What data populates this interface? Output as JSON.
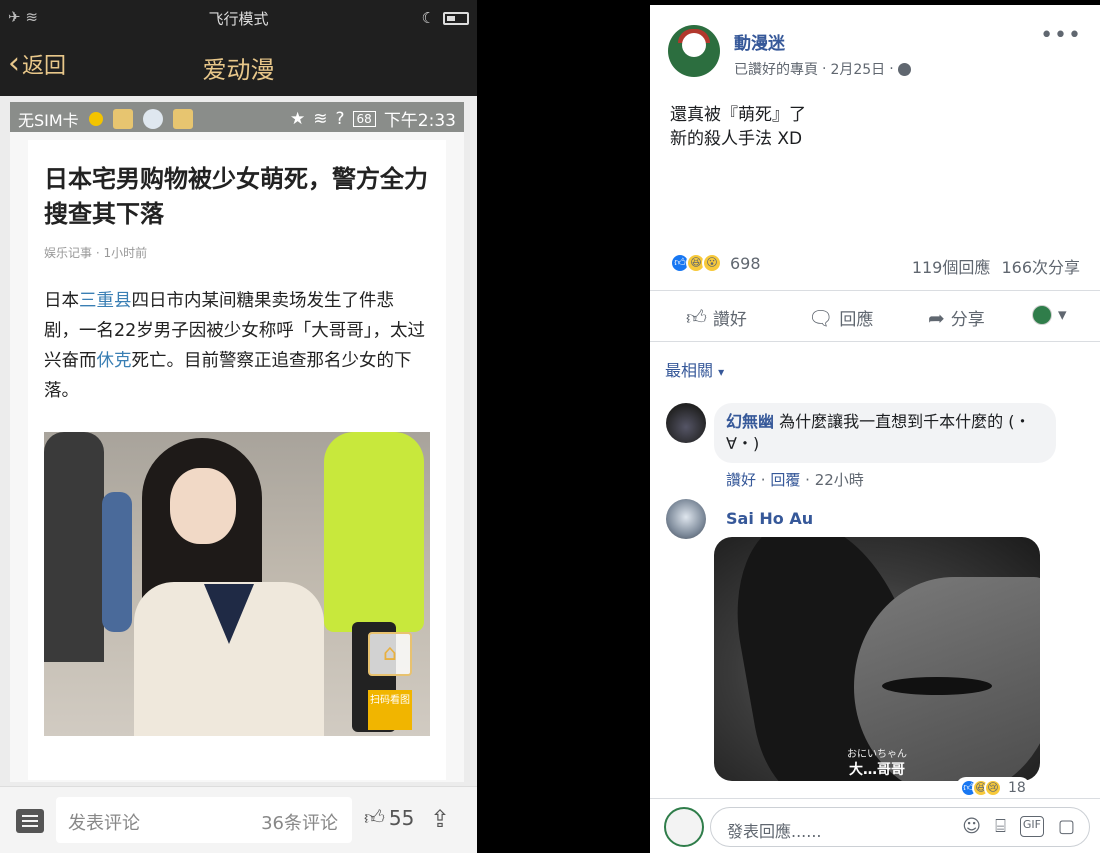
{
  "phone": {
    "status_center": "飞行模式",
    "status_left_icon": "airplane-wifi",
    "nav_back": "返回",
    "nav_title": "爱动漫",
    "inner_status": {
      "sim": "无SIM卡",
      "battery_pct": "68",
      "time": "下午2:33"
    },
    "article": {
      "title": "日本宅男购物被少女萌死，警方全力搜查其下落",
      "meta": "娱乐记事 · 1小时前",
      "body_pre": "日本",
      "body_link1": "三重县",
      "body_mid": "四日市内某间糖果卖场发生了件悲剧，一名22岁男子因被少女称呼「大哥哥」，太过兴奋而",
      "body_link2": "休克",
      "body_post": "死亡。目前警察正追查那名少女的下落。",
      "qr_text": "扫码看图"
    },
    "bottom": {
      "comment_placeholder": "发表评论",
      "comment_count": "36条评论",
      "likes": "55"
    }
  },
  "fb": {
    "page_name": "動漫迷",
    "meta_liked": "已讚好的專頁",
    "meta_date": "2月25日",
    "text_line1": "還真被『萌死』了",
    "text_line2": "新的殺人手法 XD",
    "reaction_count": "698",
    "comments_count": "119個回應",
    "shares_count": "166次分享",
    "actions": {
      "like": "讚好",
      "comment": "回應",
      "share": "分享"
    },
    "sort_label": "最相關",
    "comments": [
      {
        "name": "幻無幽",
        "text": "為什麼讓我一直想到千本什麼的 (・∀・)",
        "like": "讚好",
        "reply": "回覆",
        "time": "22小時"
      },
      {
        "name": "Sai Ho Au",
        "image_sub_small": "おにいちゃん",
        "image_sub": "大…哥哥",
        "reaction_count": "18"
      }
    ],
    "composer_placeholder": "發表回應......",
    "colors": {
      "link": "#365899",
      "like_blue": "#1877f2"
    }
  }
}
